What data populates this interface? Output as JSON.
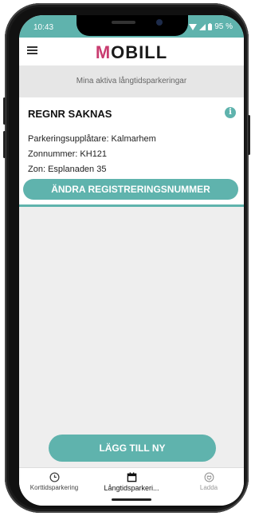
{
  "status": {
    "time": "10:43",
    "battery": "95 %"
  },
  "app": {
    "brand_first": "M",
    "brand_rest": "OBILL"
  },
  "subheader": "Mina aktiva långtidsparkeringar",
  "card": {
    "title": "REGNR SAKNAS",
    "lines": [
      "Parkeringsupplåtare: Kalmarhem",
      "Zonnummer: KH121",
      "Zon: Esplanaden 35"
    ],
    "change_button": "ÄNDRA REGISTRERINGSNUMMER"
  },
  "add_button": "LÄGG TILL NY",
  "nav": [
    {
      "label": "Korttidsparkering",
      "icon": "clock-icon"
    },
    {
      "label": "Långtidsparkeri...",
      "icon": "calendar-icon"
    },
    {
      "label": "Ladda",
      "icon": "plug-icon"
    }
  ],
  "colors": {
    "accent": "#5fb3ad",
    "brand": "#c93c70"
  }
}
